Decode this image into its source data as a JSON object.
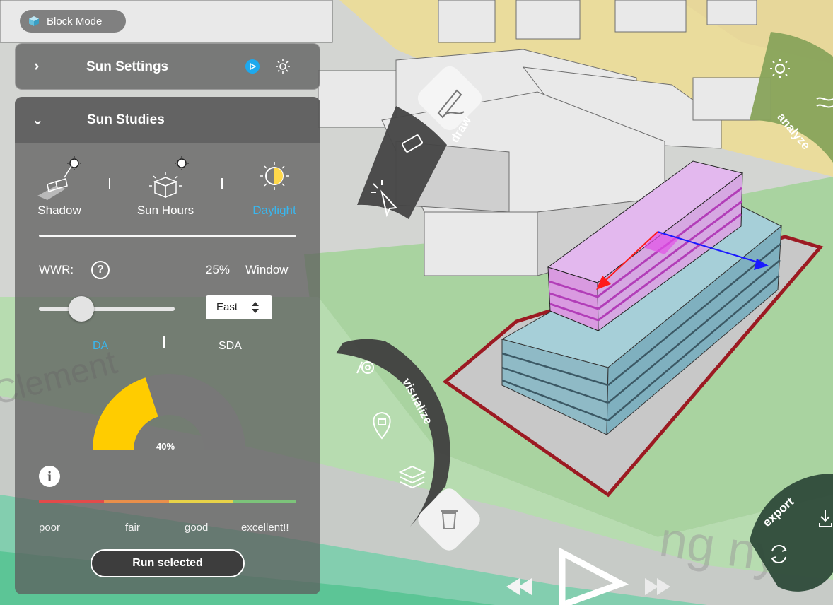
{
  "mode_badge": {
    "label": "Block Mode"
  },
  "sun_settings": {
    "title": "Sun Settings"
  },
  "sun_studies": {
    "title": "Sun Studies",
    "modes": [
      {
        "label": "Shadow",
        "active": false
      },
      {
        "label": "Sun Hours",
        "active": false
      },
      {
        "label": "Daylight",
        "active": true
      }
    ],
    "wwr": {
      "label": "WWR:",
      "help": "?",
      "value_text": "25%",
      "value": 0.25,
      "unit_label": "Window"
    },
    "orientation": {
      "selected": "East"
    },
    "metric_tabs": [
      {
        "label": "DA",
        "active": true
      },
      {
        "label": "SDA",
        "active": false
      }
    ],
    "gauge": {
      "value_text": "40%",
      "value": 0.4
    },
    "info": "i",
    "rating_scale": [
      "poor",
      "fair",
      "good",
      "excellent!!"
    ],
    "run_button": "Run selected"
  },
  "radial_menus": {
    "draw": "draw",
    "visualize": "visualize",
    "analyze": "analyze",
    "export": "export"
  },
  "colors": {
    "accent_blue": "#39b7ef",
    "gauge_fill": "#ffcc00",
    "gauge_track": "#787878",
    "scale": [
      "#e34a4a",
      "#e98f4b",
      "#e8d348",
      "#7cc37a"
    ],
    "analyze_bg": "#8aa55c",
    "radial_dark": "#444444"
  }
}
